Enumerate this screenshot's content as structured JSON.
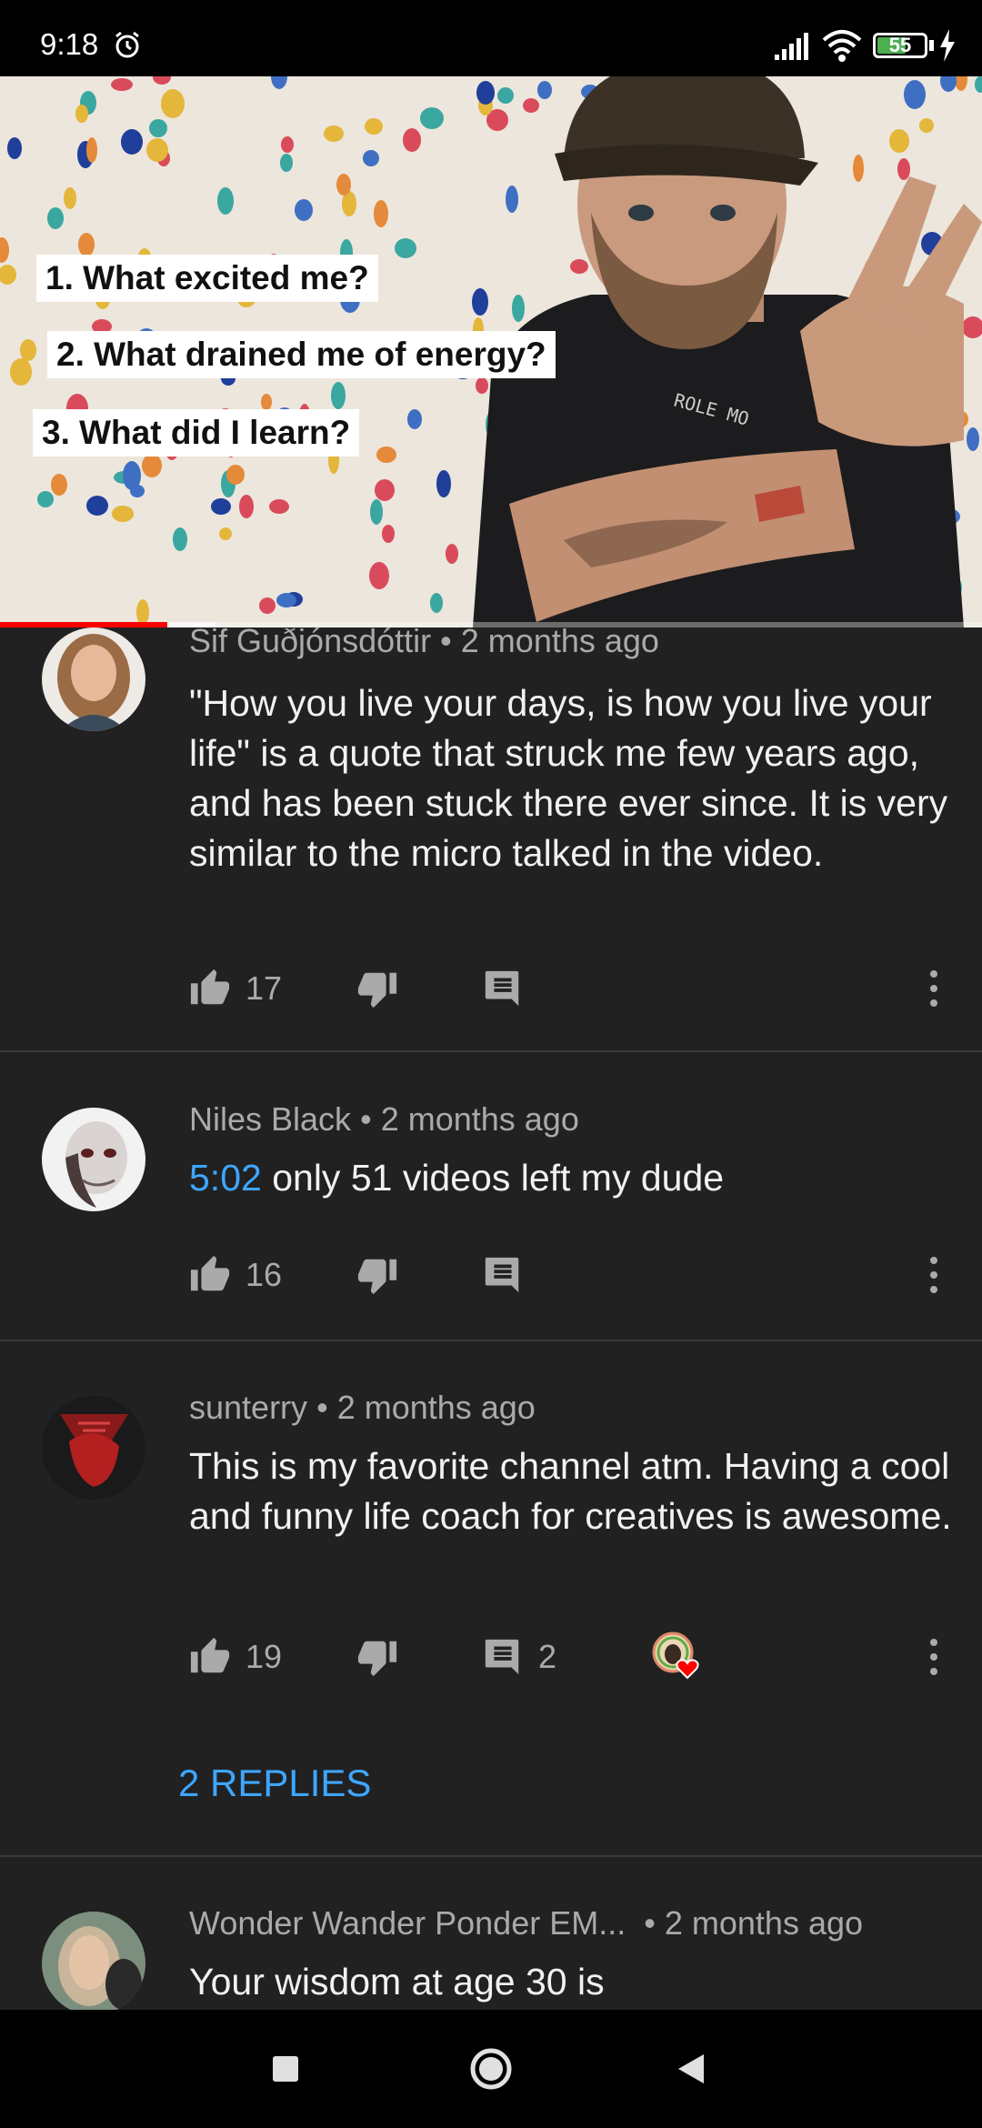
{
  "status_bar": {
    "time": "9:18",
    "battery": "55",
    "icons": [
      "alarm-icon",
      "signal-icon",
      "wifi-icon",
      "battery-icon",
      "charging-icon"
    ]
  },
  "video": {
    "captions": [
      "1. What excited me?",
      "2. What drained me of energy?",
      "3. What did I learn?"
    ],
    "shirt_text": "ROLE MO",
    "progress": 0.17,
    "buffered": 0.22
  },
  "comments": [
    {
      "author": "Sif Guðjónsdóttir",
      "time": "2 months ago",
      "text": "\"How you live your days, is how you live your life\" is a quote that struck me few years ago, and has been stuck there ever since. It is very similar to the micro talked in the video.",
      "likes": "17",
      "replies_count": ""
    },
    {
      "author": "Niles Black",
      "time": "2 months ago",
      "timestamp": "5:02",
      "text": "only 51 videos left my dude",
      "likes": "16",
      "replies_count": ""
    },
    {
      "author": "sunterry",
      "time": "2 months ago",
      "text": "This is my favorite channel atm. Having a cool and funny life coach for creatives is awesome.",
      "likes": "19",
      "replies_count": "2",
      "replies_label": "2 REPLIES"
    },
    {
      "author": "Wonder Wander Ponder EM...",
      "time": "2 months ago",
      "text": "Your wisdom at age 30 is"
    }
  ],
  "separator": "•",
  "colors": {
    "background": "#212121",
    "link": "#3ea6ff",
    "progress": "#ff0000",
    "meta": "#aaaaaa"
  }
}
